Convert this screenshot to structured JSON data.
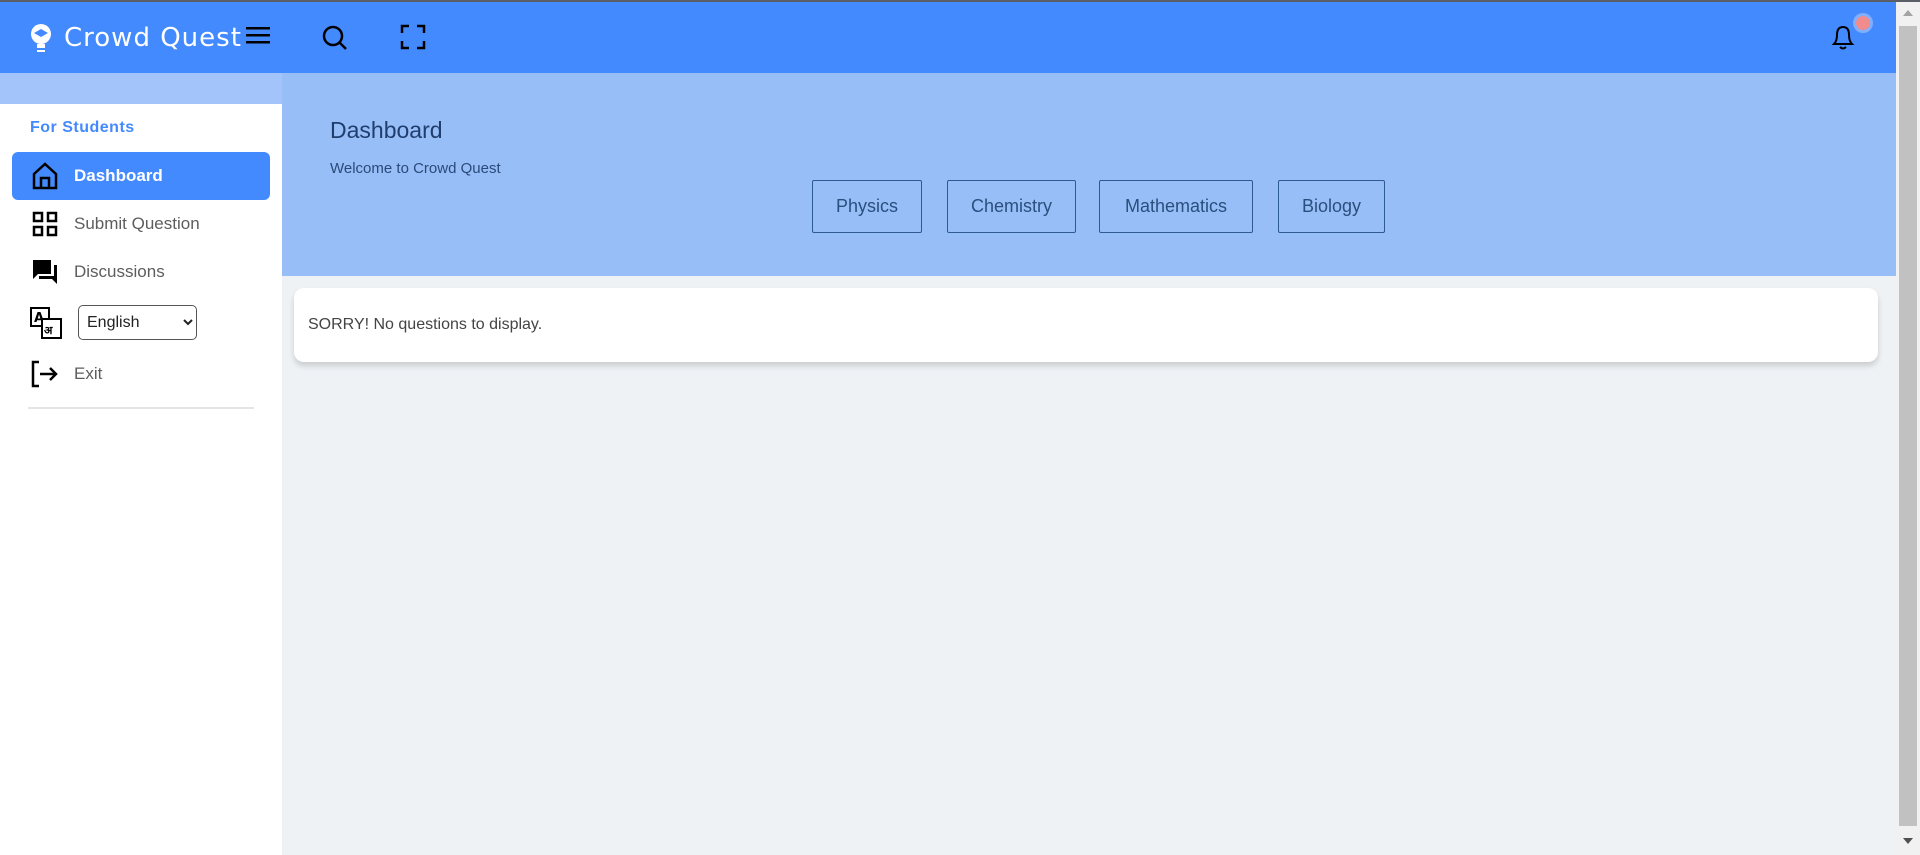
{
  "app": {
    "name": "Crowd Quest"
  },
  "header": {
    "icons": [
      "menu-icon",
      "search-icon",
      "fullscreen-icon",
      "bell-icon"
    ],
    "notification_dot_color": "#f28b8b",
    "color": "#448aff"
  },
  "sidebar": {
    "section": "For Students",
    "items": [
      {
        "label": "Dashboard",
        "icon": "home-icon",
        "active": true
      },
      {
        "label": "Submit Question",
        "icon": "grid-icon"
      },
      {
        "label": "Discussions",
        "icon": "chat-icon"
      },
      {
        "label": "Exit",
        "icon": "exit-icon"
      }
    ],
    "language": {
      "selected": "English",
      "icon": "translate-icon"
    }
  },
  "main": {
    "title": "Dashboard",
    "subtitle": "Welcome to Crowd Quest",
    "subjects": [
      "Physics",
      "Chemistry",
      "Mathematics",
      "Biology"
    ],
    "message": "SORRY! No questions to display."
  }
}
